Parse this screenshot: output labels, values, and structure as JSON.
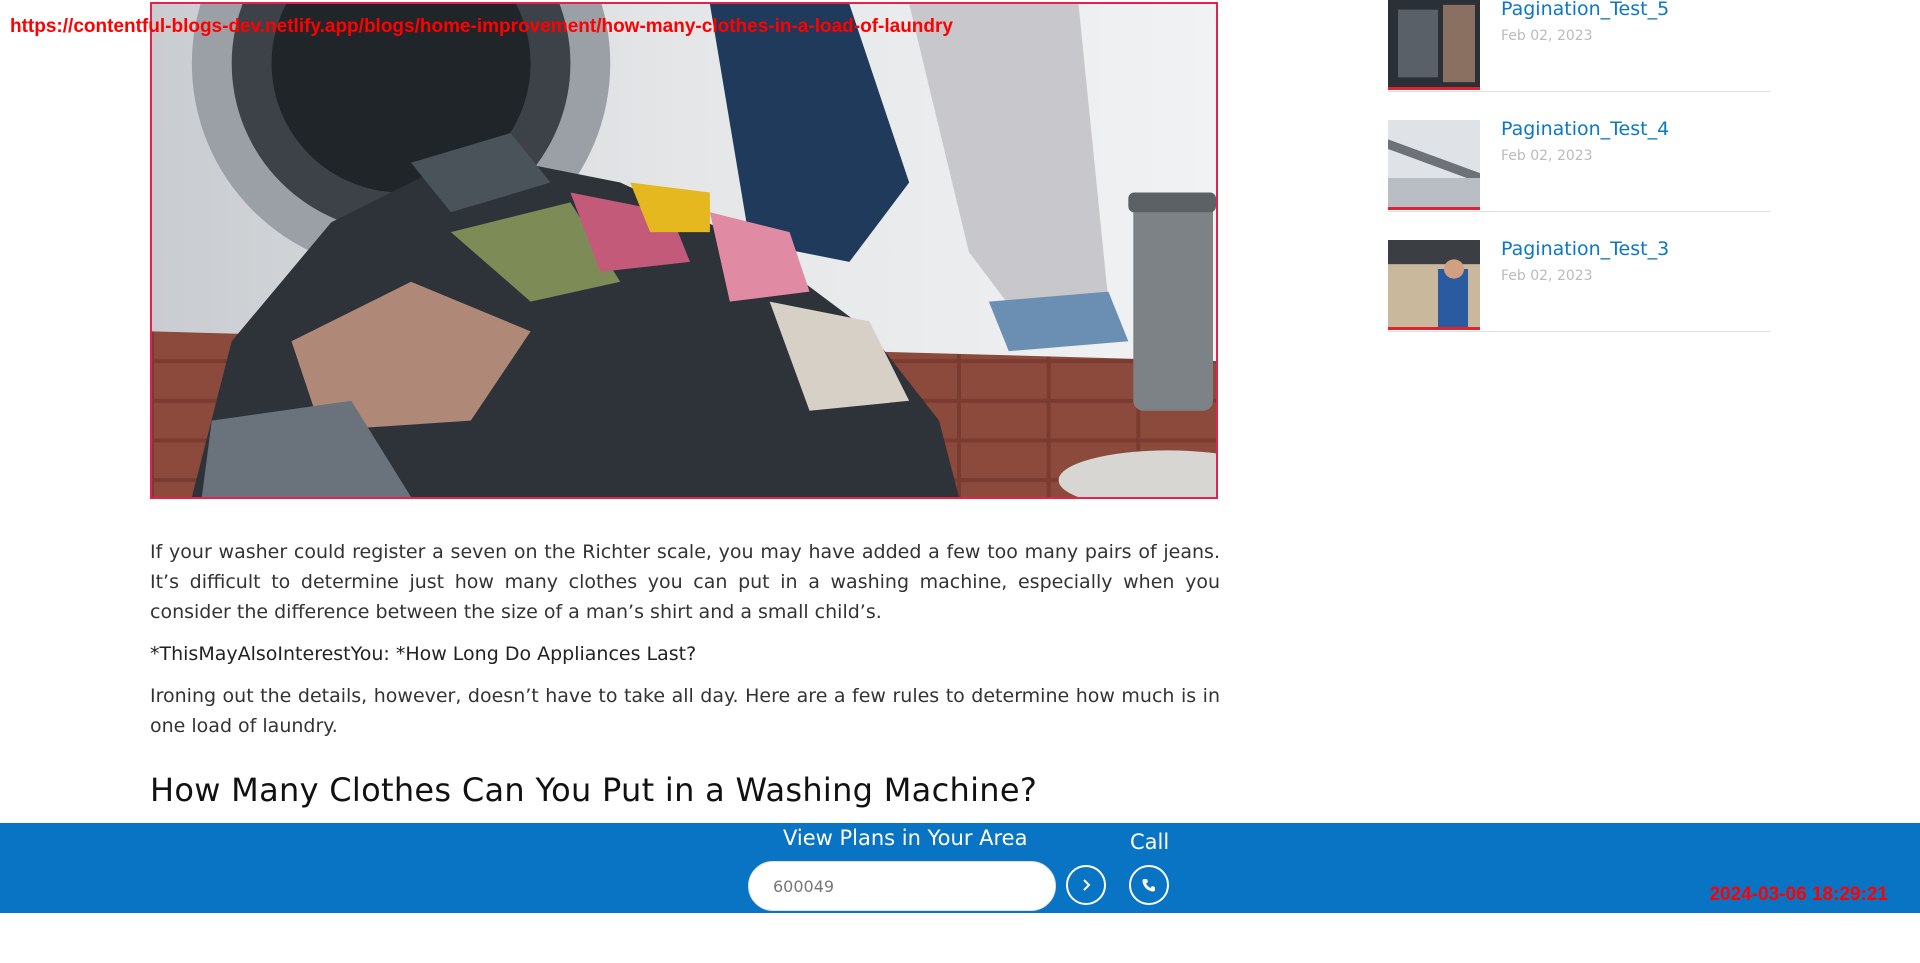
{
  "overlay": {
    "url": "https://contentful-blogs-dev.netlify.app/blogs/home-improvement/how-many-clothes-in-a-load-of-laundry",
    "timestamp": "2024-03-06 18:29:21"
  },
  "hero": {
    "image_subject": "pile of laundry in front of washing machine",
    "border_color": "#e0244e"
  },
  "article": {
    "paragraph_1": "If your washer could register a seven on the Richter scale, you may have added a few too many pairs of jeans. It’s difficult to determine just how many clothes you can put in a washing machine, especially when you consider the difference between the size of a man’s shirt and a small child’s.",
    "interest_line": "*ThisMayAlsoInterestYou: *How Long Do Appliances Last?",
    "paragraph_2": "Ironing out the details, however, doesn’t have to take all day. Here are a few rules to determine how much is in one load of laundry.",
    "heading": "How Many Clothes Can You Put in a Washing Machine?"
  },
  "sidebar": {
    "items": [
      {
        "title": "Pagination_Test_5",
        "date": "Feb 02, 2023"
      },
      {
        "title": "Pagination_Test_4",
        "date": "Feb 02, 2023"
      },
      {
        "title": "Pagination_Test_3",
        "date": "Feb 02, 2023"
      }
    ]
  },
  "bottom_bar": {
    "heading": "View Plans in Your Area",
    "zip_value": "600049",
    "call_label": "Call",
    "go_icon": "chevron-right-icon",
    "call_icon": "phone-icon",
    "background_color": "#0a74c4"
  }
}
